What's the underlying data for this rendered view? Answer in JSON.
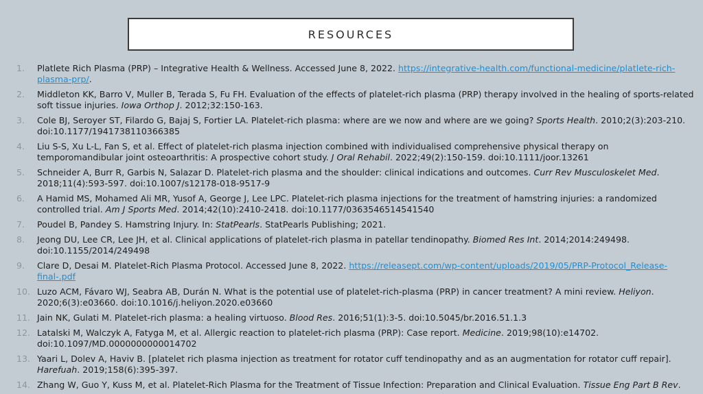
{
  "slide": {
    "title": "RESOURCES"
  },
  "references": [
    {
      "num": "1.",
      "parts": [
        {
          "t": "Platlete Rich Plasma (PRP) – Integrative Health & Wellness. Accessed June 8, 2022. "
        },
        {
          "t": "https://integrative-health.com/functional-medicine/platlete-rich-plasma-prp/",
          "link": true
        },
        {
          "t": "."
        }
      ]
    },
    {
      "num": "2.",
      "parts": [
        {
          "t": "Middleton KK, Barro V, Muller B, Terada S, Fu FH. Evaluation of the effects of platelet-rich plasma (PRP) therapy involved in the healing of sports-related soft tissue injuries. "
        },
        {
          "t": "Iowa Orthop J",
          "i": true
        },
        {
          "t": ". 2012;32:150-163."
        }
      ]
    },
    {
      "num": "3.",
      "parts": [
        {
          "t": "Cole BJ, Seroyer ST, Filardo G, Bajaj S, Fortier LA. Platelet-rich plasma: where are we now and where are we going? "
        },
        {
          "t": "Sports Health",
          "i": true
        },
        {
          "t": ". 2010;2(3):203-210. doi:10.1177/1941738110366385"
        }
      ]
    },
    {
      "num": "4.",
      "parts": [
        {
          "t": "Liu S-S, Xu L-L, Fan S, et al. Effect of platelet-rich plasma injection combined with individualised comprehensive physical therapy on temporomandibular joint osteoarthritis: A prospective cohort study. "
        },
        {
          "t": "J Oral Rehabil",
          "i": true
        },
        {
          "t": ". 2022;49(2):150-159. doi:10.1111/joor.13261"
        }
      ]
    },
    {
      "num": "5.",
      "parts": [
        {
          "t": "Schneider A, Burr R, Garbis N, Salazar D. Platelet-rich plasma and the shoulder: clinical indications and outcomes. "
        },
        {
          "t": "Curr Rev Musculoskelet Med",
          "i": true
        },
        {
          "t": ". 2018;11(4):593-597. doi:10.1007/s12178-018-9517-9"
        }
      ]
    },
    {
      "num": "6.",
      "parts": [
        {
          "t": "A Hamid MS, Mohamed Ali MR, Yusof A, George J, Lee LPC. Platelet-rich plasma injections for the treatment of hamstring injuries: a randomized controlled trial. "
        },
        {
          "t": "Am J Sports Med",
          "i": true
        },
        {
          "t": ". 2014;42(10):2410-2418. doi:10.1177/0363546514541540"
        }
      ]
    },
    {
      "num": "7.",
      "parts": [
        {
          "t": "Poudel B, Pandey S. Hamstring Injury. In: "
        },
        {
          "t": "StatPearls",
          "i": true
        },
        {
          "t": ". StatPearls Publishing; 2021."
        }
      ]
    },
    {
      "num": "8.",
      "parts": [
        {
          "t": "Jeong DU, Lee CR, Lee JH, et al. Clinical applications of platelet-rich plasma in patellar tendinopathy. "
        },
        {
          "t": "Biomed Res Int",
          "i": true
        },
        {
          "t": ". 2014;2014:249498. doi:10.1155/2014/249498"
        }
      ]
    },
    {
      "num": "9.",
      "parts": [
        {
          "t": "Clare D, Desai M. Platelet-Rich Plasma Protocol. Accessed June 8, 2022. "
        },
        {
          "t": "https://releasept.com/wp-content/uploads/2019/05/PRP-Protocol_Release-final-.pdf",
          "link": true
        }
      ]
    },
    {
      "num": "10.",
      "parts": [
        {
          "t": "Luzo ACM, Fávaro WJ, Seabra AB, Durán N. What is the potential use of platelet-rich-plasma (PRP) in cancer treatment? A mini review. "
        },
        {
          "t": "Heliyon",
          "i": true
        },
        {
          "t": ". 2020;6(3):e03660. doi:10.1016/j.heliyon.2020.e03660"
        }
      ]
    },
    {
      "num": "11.",
      "parts": [
        {
          "t": "Jain NK, Gulati M. Platelet-rich plasma: a healing virtuoso. "
        },
        {
          "t": "Blood Res",
          "i": true
        },
        {
          "t": ". 2016;51(1):3-5. doi:10.5045/br.2016.51.1.3"
        }
      ]
    },
    {
      "num": "12.",
      "parts": [
        {
          "t": "Latalski M, Walczyk A, Fatyga M, et al. Allergic reaction to platelet-rich plasma (PRP): Case report. "
        },
        {
          "t": "Medicine",
          "i": true
        },
        {
          "t": ". 2019;98(10):e14702. doi:10.1097/MD.0000000000014702"
        }
      ]
    },
    {
      "num": "13.",
      "parts": [
        {
          "t": "Yaari L, Dolev A, Haviv B. [platelet rich plasma injection as treatment for rotator cuff tendinopathy and as an augmentation for rotator cuff repair]. "
        },
        {
          "t": "Harefuah",
          "i": true
        },
        {
          "t": ". 2019;158(6):395-397."
        }
      ]
    },
    {
      "num": "14.",
      "parts": [
        {
          "t": "Zhang W, Guo Y, Kuss M, et al. Platelet-Rich Plasma for the Treatment of Tissue Infection: Preparation and Clinical Evaluation. "
        },
        {
          "t": "Tissue Eng Part B Rev",
          "i": true
        },
        {
          "t": "."
        }
      ]
    }
  ]
}
